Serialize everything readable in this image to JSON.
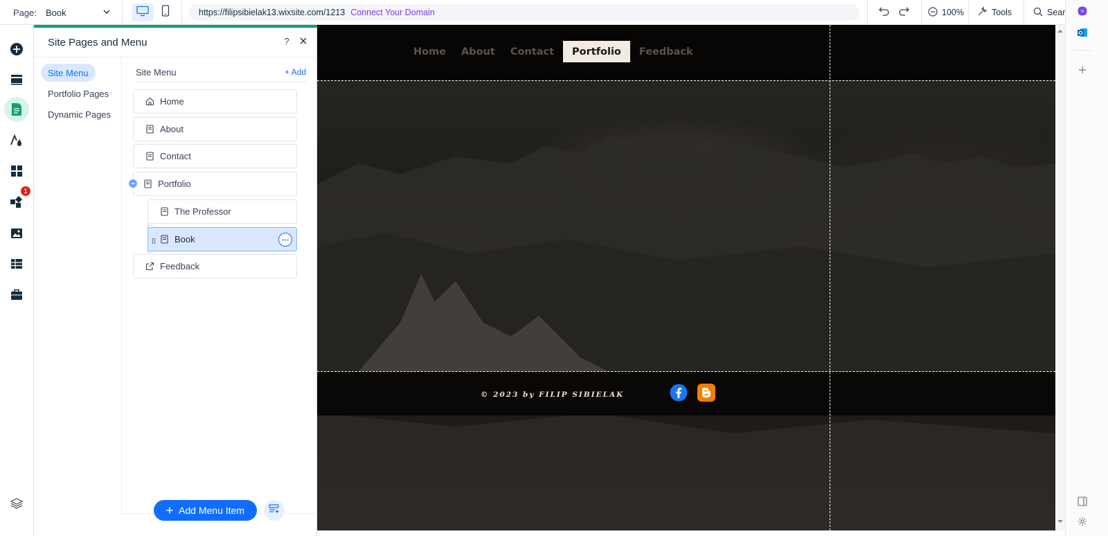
{
  "topbar": {
    "page_label": "Page:",
    "page_value": "Book",
    "url": "https://filipsibielak13.wixsite.com/1213",
    "connect_domain": "Connect Your Domain",
    "zoom": "100%",
    "tools": "Tools",
    "search": "Search"
  },
  "rail": {
    "notification_count": "1"
  },
  "panel": {
    "title": "Site Pages and Menu",
    "help": "?",
    "tabs": [
      "Site Menu",
      "Portfolio Pages",
      "Dynamic Pages"
    ],
    "menu_title": "Site Menu",
    "add_label": "Add",
    "items": [
      "Home",
      "About",
      "Contact",
      "Portfolio",
      "The Professor",
      "Book",
      "Feedback"
    ],
    "add_menu_item": "Add Menu Item"
  },
  "canvas": {
    "nav": [
      "Home",
      "About",
      "Contact",
      "Portfolio",
      "Feedback"
    ],
    "copyright": "© 2023 by FILIP SIBIELAK"
  },
  "colors": {
    "accent": "#116dff",
    "panel_accent": "#11a06a",
    "badge": "#e62214",
    "facebook": "#1877f2",
    "blogger": "#f57d00"
  }
}
